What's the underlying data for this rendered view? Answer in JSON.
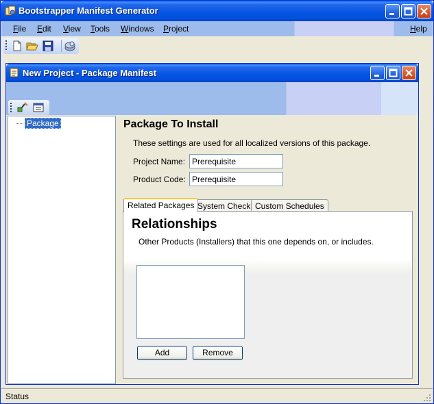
{
  "app": {
    "title": "Bootstrapper Manifest Generator",
    "menu": [
      {
        "label_u": "F",
        "label_rest": "ile"
      },
      {
        "label_u": "E",
        "label_rest": "dit"
      },
      {
        "label_u": "V",
        "label_rest": "iew"
      },
      {
        "label_u": "T",
        "label_rest": "ools"
      },
      {
        "label_u": "W",
        "label_rest": "indows"
      },
      {
        "label_u": "P",
        "label_rest": "roject"
      },
      {
        "label_u": "H",
        "label_rest": "elp"
      }
    ],
    "toolbar_icons": [
      "new-file-icon",
      "open-folder-icon",
      "save-icon",
      "build-icon"
    ]
  },
  "child": {
    "title": "New Project - Package Manifest",
    "toolbar_icons": [
      "add-item-icon",
      "properties-icon"
    ],
    "tree": {
      "root": "Package"
    },
    "panel": {
      "title": "Package To Install",
      "description": "These settings are used for all localized versions of this package.",
      "project_name_label": "Project Name:",
      "project_name_value": "Prerequisite",
      "product_code_label": "Product Code:",
      "product_code_value": "Prerequisite",
      "tabs": [
        {
          "label": "Related Packages",
          "active": true
        },
        {
          "label": "System Checks",
          "active": false
        },
        {
          "label": "Custom Schedules",
          "active": false
        }
      ],
      "relationships": {
        "title": "Relationships",
        "description": "Other Products (Installers) that this one depends on, or includes.",
        "add_label": "Add",
        "remove_label": "Remove"
      }
    }
  },
  "status": {
    "text": "Status"
  },
  "colors": {
    "titlebar": "#0454E2",
    "selection": "#316AC5",
    "tab_accent": "#FFC83C"
  }
}
